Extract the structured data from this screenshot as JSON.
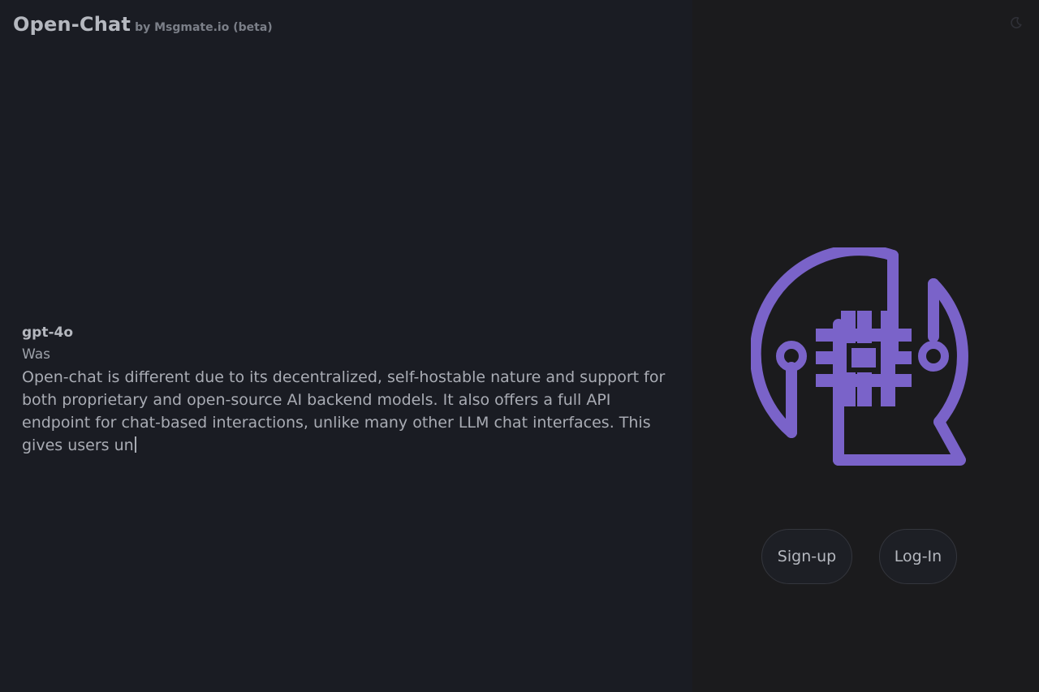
{
  "header": {
    "title": "Open-Chat",
    "subtitle": "by Msgmate.io (beta)"
  },
  "chat": {
    "model": "gpt-4o",
    "prompt": "Was",
    "response": "Open-chat is different due to its decentralized, self-hostable nature and support for both proprietary and open-source AI backend models. It also offers a full API endpoint for chat-based interactions, unlike many other LLM chat interfaces. This gives users un"
  },
  "auth": {
    "signup_label": "Sign-up",
    "login_label": "Log-In"
  },
  "icons": {
    "theme_toggle": "moon-icon",
    "logo": "ai-head-chip-logo"
  },
  "colors": {
    "accent": "#7a63c9",
    "left_bg": "#1a1c23",
    "right_bg": "#1b1b1d"
  }
}
